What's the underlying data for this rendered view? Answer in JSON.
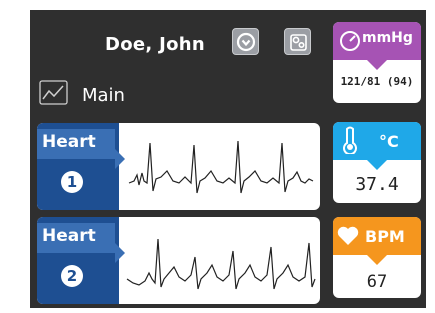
{
  "header": {
    "patient_name": "Doe, John",
    "dropdown_icon": "chevron-down-circle-icon",
    "settings_icon": "gears-icon"
  },
  "view": {
    "label": "Main",
    "icon": "line-chart-icon"
  },
  "waveforms": [
    {
      "label": "Heart",
      "number": "1"
    },
    {
      "label": "Heart",
      "number": "2"
    }
  ],
  "vitals": {
    "bp": {
      "unit": "mmHg",
      "value": "121/81 (94)",
      "icon": "gauge-icon",
      "color": "#a653b4"
    },
    "temp": {
      "unit": "°C",
      "value": "37.4",
      "icon": "thermometer-icon",
      "color": "#1fa8e8"
    },
    "pulse": {
      "unit": "BPM",
      "value": "67",
      "icon": "heart-icon",
      "color": "#f5961e"
    }
  },
  "colors": {
    "background": "#2f2f2f",
    "wave_tag": "#1e4f92",
    "wave_tag_light": "#3a6fb4"
  }
}
